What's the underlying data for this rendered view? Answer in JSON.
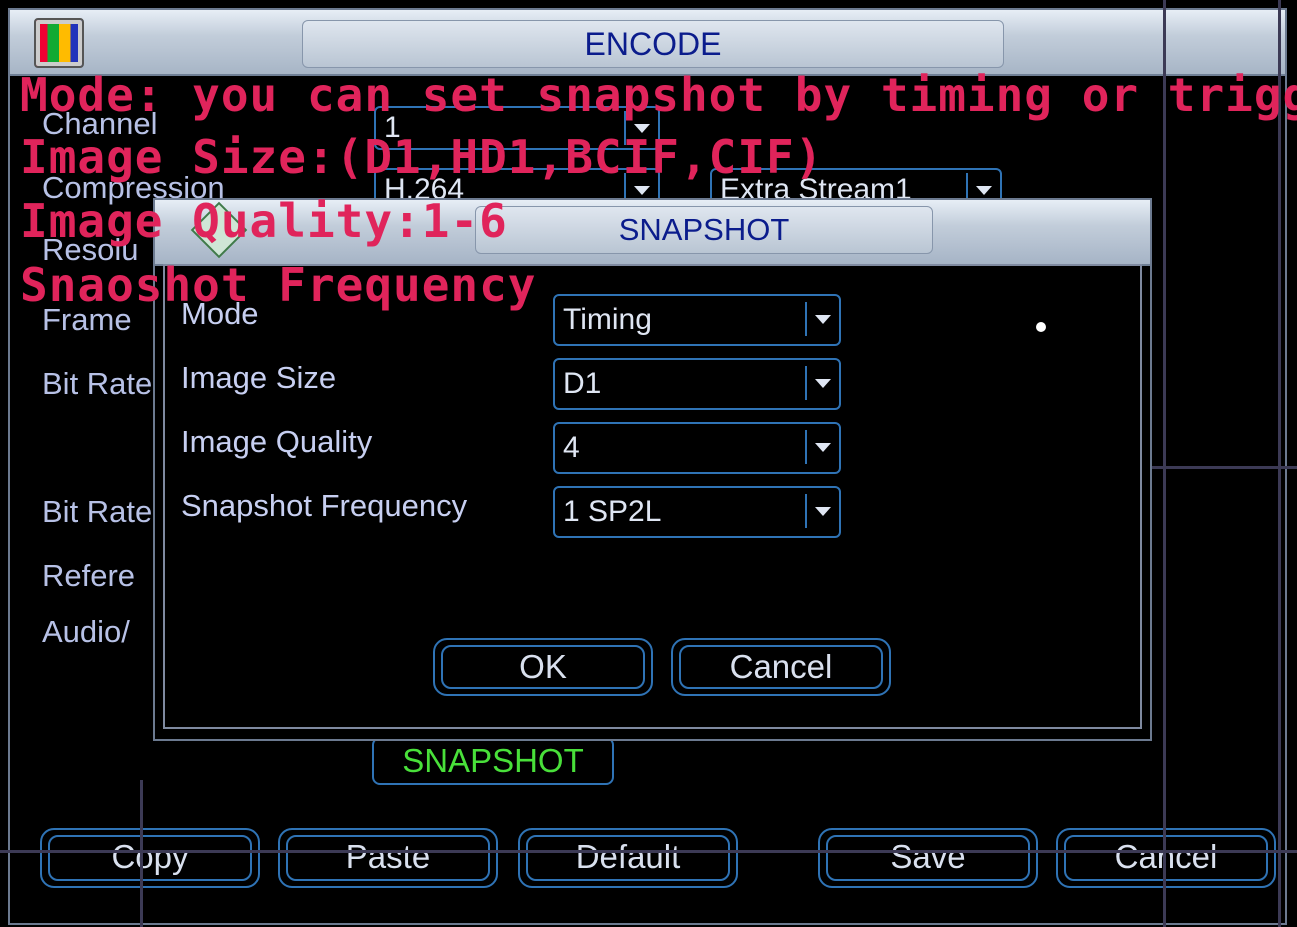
{
  "window": {
    "title": "ENCODE"
  },
  "background_labels": {
    "channel": "Channel",
    "compression": "Compression",
    "resolution": "Resolu",
    "frame": "Frame",
    "bit_rate_1": "Bit Rate",
    "bit_rate_2": "Bit Rate",
    "reference": "Refere",
    "audio": "Audio/"
  },
  "background_fields": {
    "channel_value": "1",
    "compression_value": "H.264",
    "stream_value": "Extra Stream1"
  },
  "snapshot_button": "SNAPSHOT",
  "bottom_buttons": [
    "Copy",
    "Paste",
    "Default",
    "Save",
    "Cancel"
  ],
  "dialog": {
    "title": "SNAPSHOT",
    "fields": [
      {
        "label": "Mode",
        "value": "Timing"
      },
      {
        "label": "Image Size",
        "value": "D1"
      },
      {
        "label": "Image Quality",
        "value": "4"
      },
      {
        "label": "Snapshot Frequency",
        "value": "1 SP2L"
      }
    ],
    "ok": "OK",
    "cancel": "Cancel"
  },
  "annotations": [
    "Mode: you can set snapshot by timing or trigger",
    "Image Size:(D1,HD1,BCIF,CIF)",
    "Image Quality:1-6",
    "Snaoshot Frequency"
  ],
  "colors": {
    "accent": "#2f73b5",
    "annotation": "#e0245b",
    "snapshot_text": "#49e03a",
    "title_text": "#0b1c8c"
  }
}
